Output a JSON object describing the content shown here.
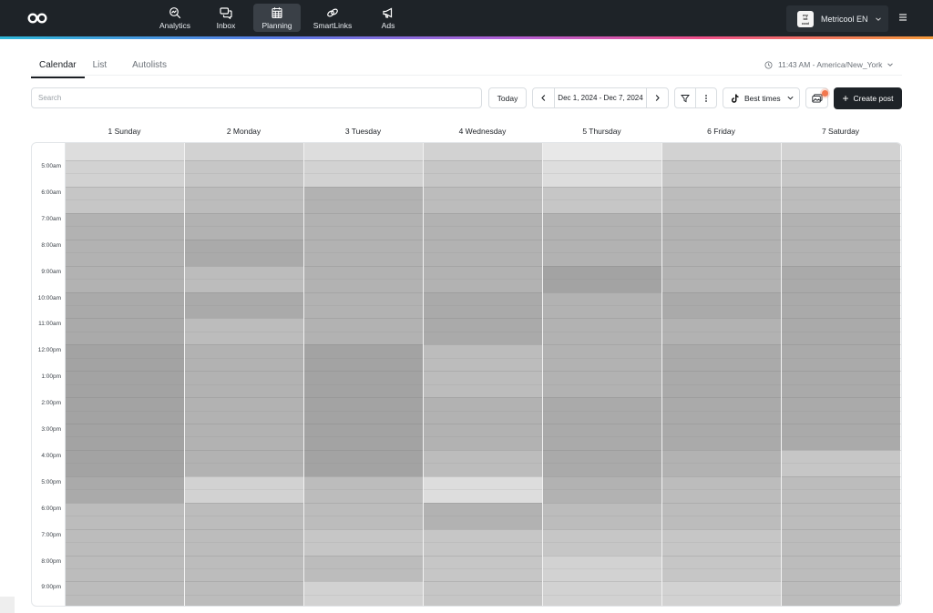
{
  "topbar": {
    "nav": [
      {
        "label": "Analytics",
        "icon": "analytics-icon",
        "active": false
      },
      {
        "label": "Inbox",
        "icon": "inbox-icon",
        "active": false
      },
      {
        "label": "Planning",
        "icon": "calendar-icon",
        "active": true
      },
      {
        "label": "SmartLinks",
        "icon": "link-icon",
        "active": false
      },
      {
        "label": "Ads",
        "icon": "megaphone-icon",
        "active": false
      }
    ],
    "account": {
      "name": "Metricool EN",
      "logo_text": "my bit cool"
    }
  },
  "tabs": [
    {
      "label": "Calendar",
      "active": true
    },
    {
      "label": "List",
      "active": false
    },
    {
      "label": "Autolists",
      "active": false
    }
  ],
  "timezone": {
    "text": "11:43 AM - America/New_York"
  },
  "toolbar": {
    "search_placeholder": "Search",
    "today_label": "Today",
    "date_range": "Dec 1, 2024 - Dec 7, 2024",
    "best_times_label": "Best times",
    "create_label": "Create post"
  },
  "calendar": {
    "days": [
      "1 Sunday",
      "2 Monday",
      "3 Tuesday",
      "4 Wednesday",
      "5 Thursday",
      "6 Friday",
      "7 Saturday"
    ],
    "hours": [
      "5:00am",
      "6:00am",
      "7:00am",
      "8:00am",
      "9:00am",
      "10:00am",
      "11:00am",
      "12:00pm",
      "1:00pm",
      "2:00pm",
      "3:00pm",
      "4:00pm",
      "5:00pm",
      "6:00pm",
      "7:00pm",
      "8:00pm",
      "9:00pm"
    ],
    "heatmap": [
      [
        2,
        3,
        2,
        3,
        1,
        3,
        3
      ],
      [
        3,
        4,
        3,
        4,
        2,
        4,
        4
      ],
      [
        4,
        5,
        6,
        5,
        4,
        5,
        5
      ],
      [
        6,
        6,
        6,
        6,
        6,
        6,
        6
      ],
      [
        6,
        7,
        6,
        6,
        6,
        6,
        6
      ],
      [
        6,
        5,
        6,
        6,
        8,
        6,
        7
      ],
      [
        7,
        7,
        6,
        7,
        6,
        7,
        7
      ],
      [
        7,
        5,
        6,
        7,
        6,
        6,
        7
      ],
      [
        8,
        6,
        8,
        5,
        6,
        7,
        7
      ],
      [
        8,
        6,
        8,
        5,
        6,
        7,
        7
      ],
      [
        8,
        6,
        8,
        6,
        7,
        7,
        7
      ],
      [
        8,
        6,
        8,
        6,
        7,
        7,
        7
      ],
      [
        8,
        6,
        8,
        5,
        7,
        6,
        4
      ],
      [
        7,
        3,
        5,
        2,
        6,
        5,
        5
      ],
      [
        5,
        5,
        5,
        6,
        5,
        5,
        5
      ],
      [
        5,
        5,
        4,
        4,
        4,
        4,
        5
      ],
      [
        5,
        5,
        5,
        4,
        3,
        4,
        5
      ],
      [
        5,
        5,
        3,
        4,
        3,
        3,
        5
      ]
    ],
    "heat_colors": [
      "#f5f5f5",
      "#e8e8e8",
      "#dddddd",
      "#d2d2d2",
      "#c6c6c6",
      "#bcbcbc",
      "#b2b2b2",
      "#aaaaaa",
      "#a3a3a3"
    ]
  }
}
